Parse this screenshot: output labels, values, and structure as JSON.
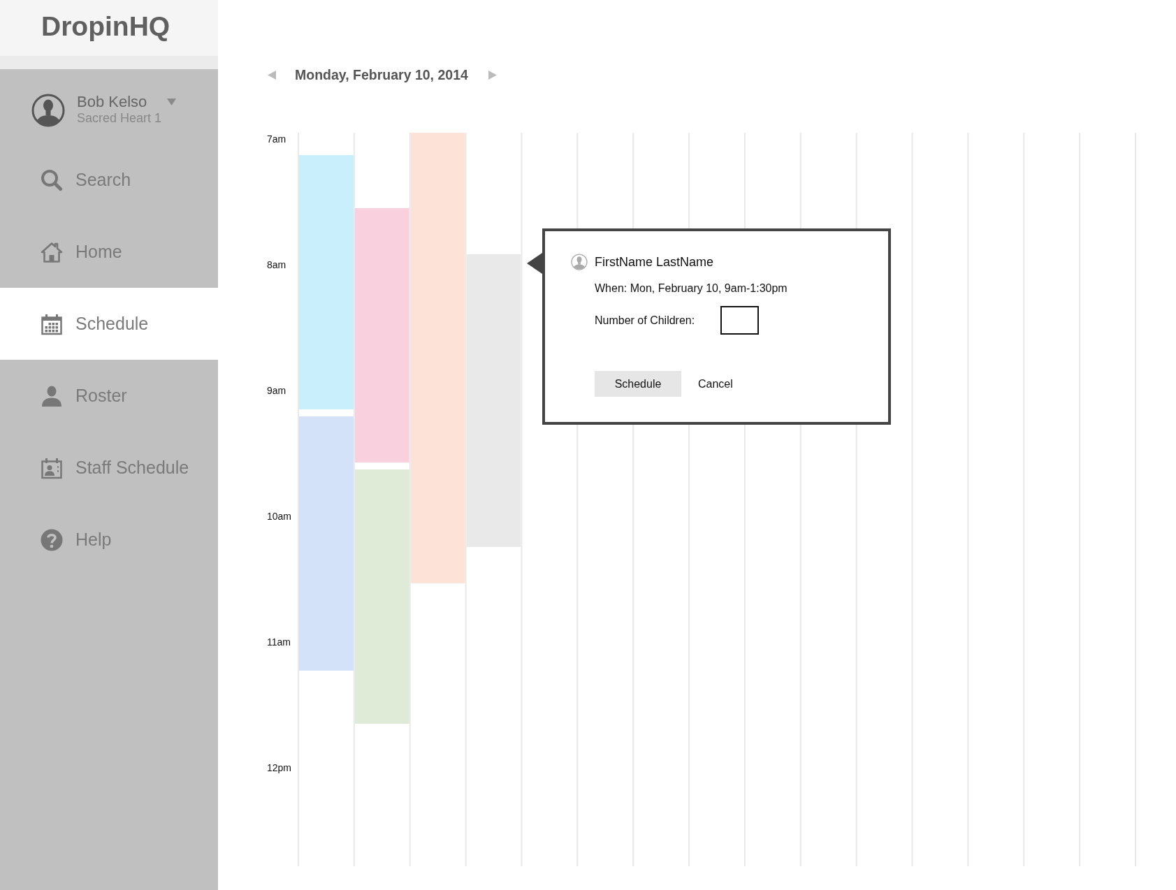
{
  "sidebar": {
    "logo": "DropinHQ",
    "user": {
      "name": "Bob Kelso",
      "location": "Sacred Heart 1"
    },
    "items": [
      {
        "label": "Search",
        "kind": "search",
        "selected": false
      },
      {
        "label": "Home",
        "kind": "home",
        "selected": false
      },
      {
        "label": "Schedule",
        "kind": "calendar",
        "selected": true
      },
      {
        "label": "Roster",
        "kind": "person",
        "selected": false
      },
      {
        "label": "Staff Schedule",
        "kind": "staff",
        "selected": false
      },
      {
        "label": "Help",
        "kind": "help",
        "selected": false
      }
    ]
  },
  "date_nav": {
    "date": "Monday, February 10, 2014"
  },
  "schedule": {
    "hours": [
      "7am",
      "8am",
      "9am",
      "10am",
      "11am",
      "12pm"
    ],
    "lanes": [
      [
        {
          "color": "#c9effc"
        },
        {
          "color": "#d3e2f9"
        }
      ],
      [
        {
          "color": "#f9d1de"
        },
        {
          "color": "#dfebd6"
        }
      ],
      [
        {
          "color": "#fde2d8"
        }
      ],
      [
        {
          "color": "#e9e9e9"
        }
      ]
    ]
  },
  "popover": {
    "name": "FirstName LastName",
    "when": "When: Mon, February 10, 9am-1:30pm",
    "field": {
      "label": "Number of Children:"
    },
    "buttons": [
      {
        "label": "Schedule",
        "kind": "primary"
      },
      {
        "label": "Cancel",
        "kind": "plain"
      }
    ]
  }
}
